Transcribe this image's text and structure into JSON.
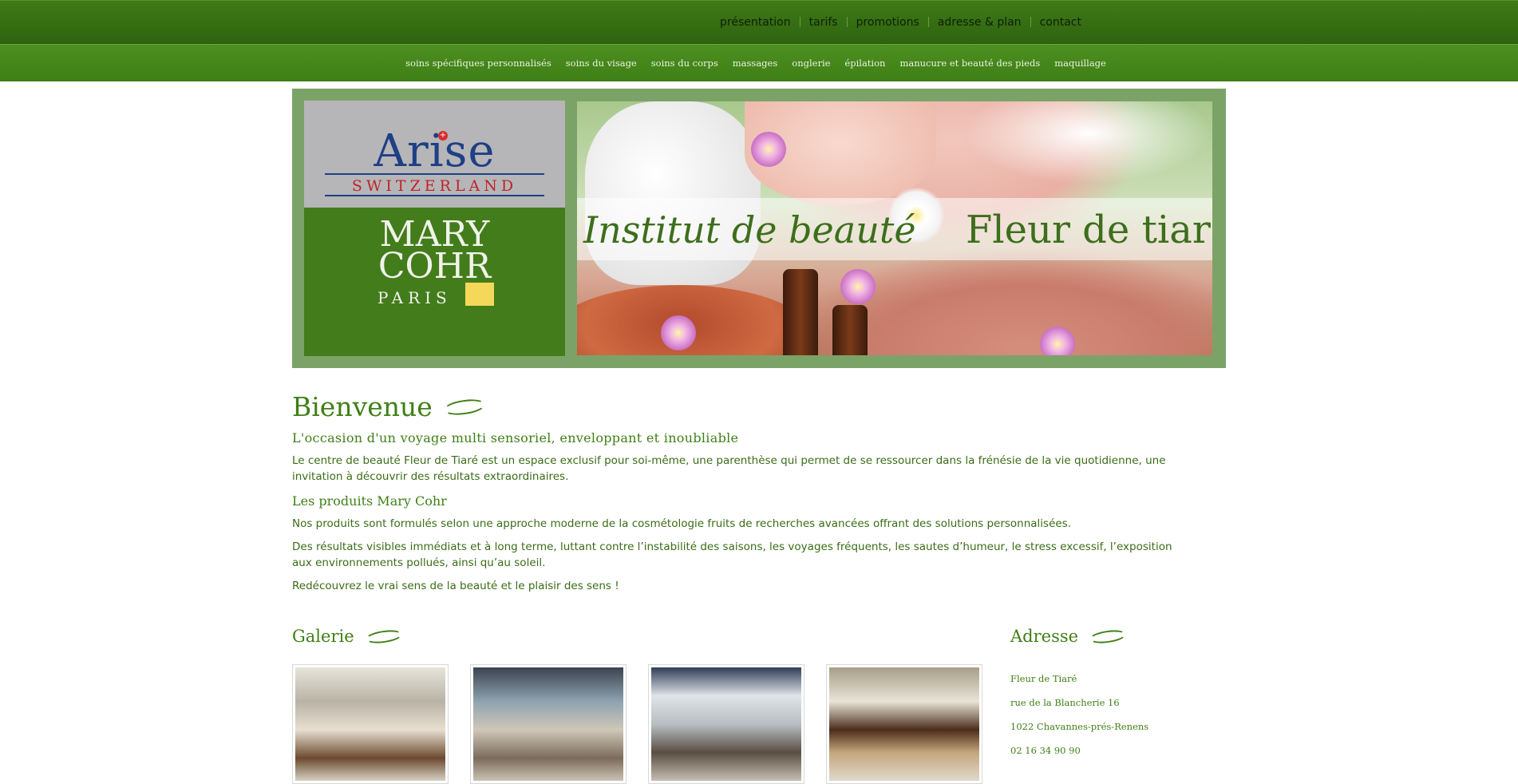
{
  "top_nav": {
    "items": [
      "présentation",
      "tarifs",
      "promotions",
      "adresse & plan",
      "contact"
    ]
  },
  "sub_nav": {
    "items": [
      "soins spécifiques personnalisés",
      "soins du visage",
      "soins du corps",
      "massages",
      "onglerie",
      "épilation",
      "manucure et beauté des pieds",
      "maquillage"
    ]
  },
  "banner": {
    "arise_name": "Arise",
    "arise_sub": "SWITZERLAND",
    "mary_l1": "MARY",
    "mary_l2": "COHR",
    "mary_paris": "PARIS",
    "title_left": "Institut de beauté",
    "title_right": "Fleur de tiaré"
  },
  "welcome": {
    "title": "Bienvenue",
    "subtitle": "L'occasion d'un voyage multi sensoriel, enveloppant et inoubliable",
    "intro": "Le centre de beauté Fleur de Tiaré est un espace exclusif pour soi-même, une parenthèse qui permet de se ressourcer dans la frénésie de la vie quotidienne, une invitation à découvrir des résultats extraordinaires.",
    "products_title": "Les produits Mary Cohr",
    "p1": "Nos produits sont formulés selon une approche moderne de la cosmétologie fruits de recherches avancées offrant des solutions personnalisées.",
    "p2": "Des résultats visibles immédiats et à long terme, luttant contre l’instabilité des saisons, les voyages fréquents, les sautes d’humeur, le stress excessif, l’exposition aux environnements pollués, ainsi qu’au soleil.",
    "p3": "Redécouvrez le vrai sens de la beauté et le plaisir des sens !"
  },
  "gallery": {
    "title": "Galerie"
  },
  "address": {
    "title": "Adresse",
    "lines": [
      "Fleur de Tiaré",
      "rue de la Blancherie 16",
      "1022 Chavannes-prés-Renens",
      "02 16 34 90 90"
    ]
  },
  "colors": {
    "top_bar": "#2e6410",
    "sub_bar": "#4d8f21",
    "banner_frame": "#7ca367",
    "accent_text": "#3f7f16"
  }
}
